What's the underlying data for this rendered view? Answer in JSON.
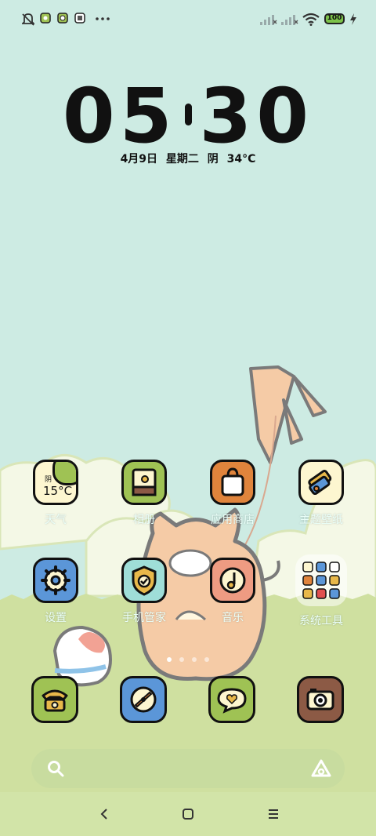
{
  "status_bar": {
    "icons": [
      "mute-bell-icon",
      "app-notification-icon",
      "app-notification-icon",
      "app-notification-icon",
      "more-dots-icon"
    ],
    "right_icons": [
      "signal-off-icon",
      "signal-off-icon",
      "wifi-icon",
      "battery-icon",
      "charging-bolt-icon"
    ],
    "battery_level": "100"
  },
  "clock": {
    "hours": "05",
    "minutes": "30"
  },
  "date_line": "4月9日  星期二  阴  34°C",
  "apps": [
    {
      "label": "天气",
      "weather_word": "阴",
      "weather_temp": "15°C",
      "icon": "weather-icon"
    },
    {
      "label": "相册",
      "icon": "gallery-icon"
    },
    {
      "label": "应用商店",
      "icon": "app-store-icon"
    },
    {
      "label": "主题壁纸",
      "icon": "themes-icon"
    },
    {
      "label": "设置",
      "icon": "settings-gear-icon"
    },
    {
      "label": "手机管家",
      "icon": "security-shield-icon"
    },
    {
      "label": "音乐",
      "icon": "music-icon"
    },
    {
      "label": "系统工具",
      "icon": "folder-icon"
    }
  ],
  "dock": [
    {
      "icon": "phone-icon"
    },
    {
      "icon": "browser-icon"
    },
    {
      "icon": "messages-icon"
    },
    {
      "icon": "camera-icon"
    }
  ],
  "page_indicator": {
    "count": 4,
    "active": 1
  },
  "search_bar": {
    "left_icon": "search-icon",
    "right_icon": "assistant-icon"
  },
  "nav_bar": [
    "back-icon",
    "home-icon",
    "recents-icon"
  ],
  "colors": {
    "sky": "#cdebe3",
    "grass": "#cfe0a0",
    "cloud": "#f4f8e6",
    "outline": "#111111",
    "icon_yellow": "#fdf6d0",
    "icon_green": "#9fc254",
    "icon_orange": "#e0843c",
    "icon_blue": "#5b96d8",
    "icon_teal": "#9fded8",
    "icon_salmon": "#ee9b82",
    "icon_brown": "#8c5a45"
  }
}
